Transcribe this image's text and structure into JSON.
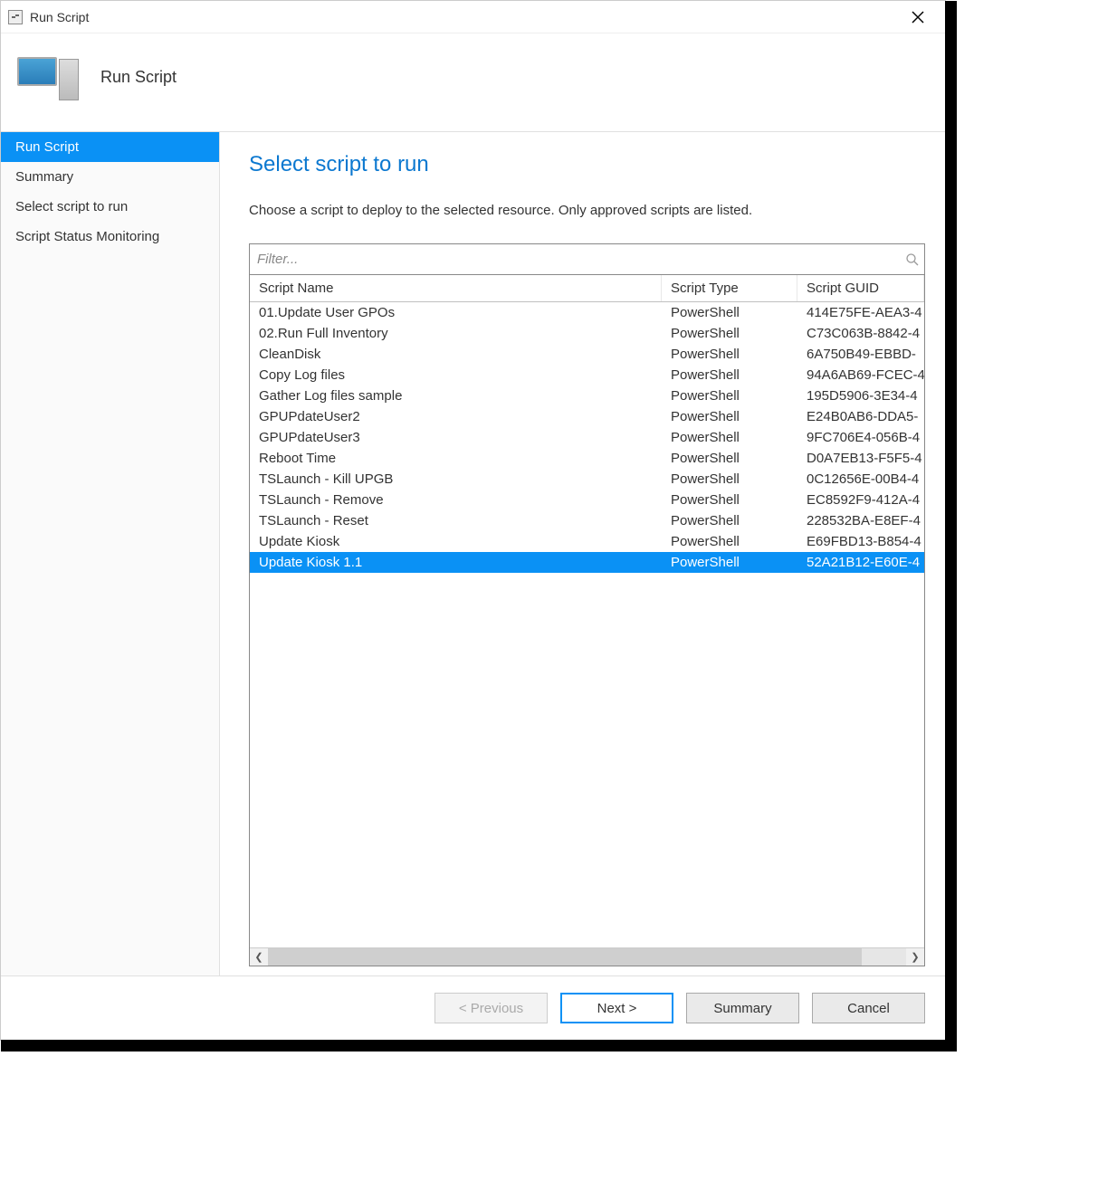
{
  "window": {
    "title": "Run Script"
  },
  "header": {
    "title": "Run Script"
  },
  "sidebar": {
    "items": [
      {
        "label": "Run Script",
        "active": true
      },
      {
        "label": "Summary",
        "active": false
      },
      {
        "label": "Select script to run",
        "active": false
      },
      {
        "label": "Script Status Monitoring",
        "active": false
      }
    ]
  },
  "main": {
    "title": "Select script to run",
    "description": "Choose a script to deploy to the selected resource. Only approved scripts are listed.",
    "filter_placeholder": "Filter...",
    "columns": {
      "name": "Script Name",
      "type": "Script Type",
      "guid": "Script GUID"
    },
    "rows": [
      {
        "name": "01.Update User GPOs",
        "type": "PowerShell",
        "guid": "414E75FE-AEA3-4",
        "selected": false
      },
      {
        "name": "02.Run Full Inventory",
        "type": "PowerShell",
        "guid": "C73C063B-8842-4",
        "selected": false
      },
      {
        "name": "CleanDisk",
        "type": "PowerShell",
        "guid": "6A750B49-EBBD-",
        "selected": false
      },
      {
        "name": "Copy Log files",
        "type": "PowerShell",
        "guid": "94A6AB69-FCEC-4",
        "selected": false
      },
      {
        "name": "Gather Log files sample",
        "type": "PowerShell",
        "guid": "195D5906-3E34-4",
        "selected": false
      },
      {
        "name": "GPUPdateUser2",
        "type": "PowerShell",
        "guid": "E24B0AB6-DDA5-",
        "selected": false
      },
      {
        "name": "GPUPdateUser3",
        "type": "PowerShell",
        "guid": "9FC706E4-056B-4",
        "selected": false
      },
      {
        "name": "Reboot Time",
        "type": "PowerShell",
        "guid": "D0A7EB13-F5F5-4",
        "selected": false
      },
      {
        "name": "TSLaunch - Kill UPGB",
        "type": "PowerShell",
        "guid": "0C12656E-00B4-4",
        "selected": false
      },
      {
        "name": "TSLaunch - Remove",
        "type": "PowerShell",
        "guid": "EC8592F9-412A-4",
        "selected": false
      },
      {
        "name": "TSLaunch - Reset",
        "type": "PowerShell",
        "guid": "228532BA-E8EF-4",
        "selected": false
      },
      {
        "name": "Update Kiosk",
        "type": "PowerShell",
        "guid": "E69FBD13-B854-4",
        "selected": false
      },
      {
        "name": "Update Kiosk 1.1",
        "type": "PowerShell",
        "guid": "52A21B12-E60E-4",
        "selected": true
      }
    ]
  },
  "footer": {
    "previous": "< Previous",
    "next": "Next >",
    "summary": "Summary",
    "cancel": "Cancel"
  }
}
